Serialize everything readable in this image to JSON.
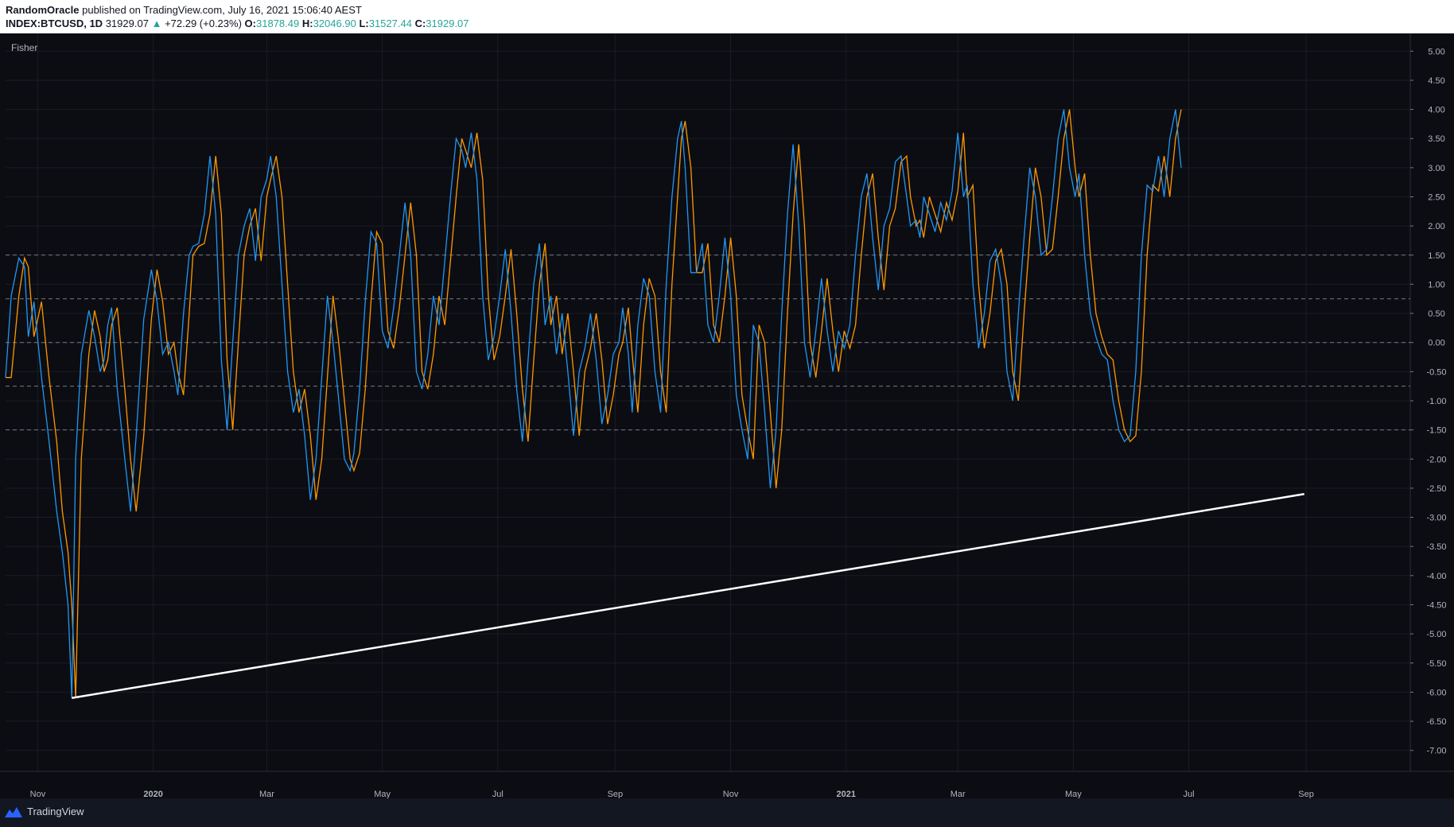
{
  "header": {
    "author": "RandomOracle",
    "published": "published on TradingView.com, July 16, 2021 15:06:40 AEST",
    "symbol": "INDEX:BTCUSD, 1D",
    "last_price": "31929.07",
    "change": "+72.29 (+0.23%)",
    "open_label": "O:",
    "open": "31878.49",
    "high_label": "H:",
    "high": "32046.90",
    "low_label": "L:",
    "low": "31527.44",
    "close_label": "C:",
    "close": "31929.07"
  },
  "indicator_label": "Fisher",
  "footer": {
    "brand": "TradingView",
    "logo_icon": "tradingview-logo-icon"
  },
  "colors": {
    "background": "#0c0d12",
    "fisher": "#2196f3",
    "trigger": "#ff9800",
    "trendline": "#ffffff",
    "levels": "#787b86",
    "axis_text": "#b2b5be",
    "up": "#26a69a"
  },
  "chart_data": {
    "type": "line",
    "title": "",
    "indicator": "Fisher",
    "x_axis": {
      "type": "date",
      "start": "2019-10-15",
      "end": "2021-10-26",
      "ticks": [
        {
          "date": "2019-11-01",
          "label": "Nov",
          "bold": false
        },
        {
          "date": "2020-01-01",
          "label": "2020",
          "bold": true
        },
        {
          "date": "2020-03-01",
          "label": "Mar",
          "bold": false
        },
        {
          "date": "2020-05-01",
          "label": "May",
          "bold": false
        },
        {
          "date": "2020-07-01",
          "label": "Jul",
          "bold": false
        },
        {
          "date": "2020-09-01",
          "label": "Sep",
          "bold": false
        },
        {
          "date": "2020-11-01",
          "label": "Nov",
          "bold": false
        },
        {
          "date": "2021-01-01",
          "label": "2021",
          "bold": true
        },
        {
          "date": "2021-03-01",
          "label": "Mar",
          "bold": false
        },
        {
          "date": "2021-05-01",
          "label": "May",
          "bold": false
        },
        {
          "date": "2021-07-01",
          "label": "Jul",
          "bold": false
        },
        {
          "date": "2021-09-01",
          "label": "Sep",
          "bold": false
        }
      ]
    },
    "y_axis": {
      "range": [
        -7.25,
        5.25
      ],
      "ticks": [
        "5.00",
        "4.50",
        "4.00",
        "3.50",
        "3.00",
        "2.50",
        "2.00",
        "1.50",
        "1.00",
        "0.50",
        "0.00",
        "-0.50",
        "-1.00",
        "-1.50",
        "-2.00",
        "-2.50",
        "-3.00",
        "-3.50",
        "-4.00",
        "-4.50",
        "-5.00",
        "-5.50",
        "-6.00",
        "-6.50",
        "-7.00"
      ]
    },
    "levels": [
      1.5,
      0.75,
      0,
      -0.75,
      -1.5
    ],
    "grid": true,
    "legend": "none",
    "series": [
      {
        "points": [
          [
            "2019-10-15",
            -0.6
          ],
          [
            "2019-10-18",
            0.8
          ],
          [
            "2019-10-22",
            1.45
          ],
          [
            "2019-10-25",
            1.3
          ],
          [
            "2019-10-27",
            0.1
          ],
          [
            "2019-10-30",
            0.7
          ],
          [
            "2019-11-03",
            -0.6
          ],
          [
            "2019-11-07",
            -1.7
          ],
          [
            "2019-11-11",
            -2.9
          ],
          [
            "2019-11-14",
            -3.6
          ],
          [
            "2019-11-17",
            -4.5
          ],
          [
            "2019-11-19",
            -6.1
          ],
          [
            "2019-11-21",
            -2.0
          ],
          [
            "2019-11-24",
            -0.2
          ],
          [
            "2019-11-28",
            0.55
          ],
          [
            "2019-12-01",
            0.1
          ],
          [
            "2019-12-04",
            -0.5
          ],
          [
            "2019-12-06",
            -0.3
          ],
          [
            "2019-12-08",
            0.3
          ],
          [
            "2019-12-10",
            0.6
          ],
          [
            "2019-12-13",
            -0.8
          ],
          [
            "2019-12-17",
            -2.0
          ],
          [
            "2019-12-20",
            -2.9
          ],
          [
            "2019-12-23",
            -1.6
          ],
          [
            "2019-12-27",
            0.4
          ],
          [
            "2019-12-31",
            1.25
          ],
          [
            "2020-01-03",
            0.7
          ],
          [
            "2020-01-06",
            -0.2
          ],
          [
            "2020-01-09",
            0.0
          ],
          [
            "2020-01-12",
            -0.5
          ],
          [
            "2020-01-14",
            -0.9
          ],
          [
            "2020-01-17",
            0.5
          ],
          [
            "2020-01-20",
            1.5
          ],
          [
            "2020-01-22",
            1.65
          ],
          [
            "2020-01-25",
            1.7
          ],
          [
            "2020-01-28",
            2.2
          ],
          [
            "2020-01-31",
            3.2
          ],
          [
            "2020-02-03",
            2.2
          ],
          [
            "2020-02-06",
            -0.3
          ],
          [
            "2020-02-09",
            -1.5
          ],
          [
            "2020-02-12",
            0.0
          ],
          [
            "2020-02-15",
            1.5
          ],
          [
            "2020-02-18",
            2.0
          ],
          [
            "2020-02-21",
            2.3
          ],
          [
            "2020-02-24",
            1.4
          ],
          [
            "2020-02-27",
            2.5
          ],
          [
            "2020-03-01",
            2.8
          ],
          [
            "2020-03-03",
            3.2
          ],
          [
            "2020-03-06",
            2.5
          ],
          [
            "2020-03-09",
            1.0
          ],
          [
            "2020-03-12",
            -0.5
          ],
          [
            "2020-03-15",
            -1.2
          ],
          [
            "2020-03-18",
            -0.8
          ],
          [
            "2020-03-21",
            -1.6
          ],
          [
            "2020-03-24",
            -2.7
          ],
          [
            "2020-03-27",
            -2.0
          ],
          [
            "2020-03-30",
            -0.6
          ],
          [
            "2020-04-02",
            0.8
          ],
          [
            "2020-04-05",
            0.0
          ],
          [
            "2020-04-08",
            -1.0
          ],
          [
            "2020-04-11",
            -2.0
          ],
          [
            "2020-04-14",
            -2.2
          ],
          [
            "2020-04-16",
            -1.9
          ],
          [
            "2020-04-19",
            -0.8
          ],
          [
            "2020-04-22",
            0.7
          ],
          [
            "2020-04-25",
            1.9
          ],
          [
            "2020-04-28",
            1.7
          ],
          [
            "2020-05-01",
            0.2
          ],
          [
            "2020-05-04",
            -0.1
          ],
          [
            "2020-05-07",
            0.6
          ],
          [
            "2020-05-10",
            1.5
          ],
          [
            "2020-05-13",
            2.4
          ],
          [
            "2020-05-16",
            1.5
          ],
          [
            "2020-05-19",
            -0.5
          ],
          [
            "2020-05-22",
            -0.8
          ],
          [
            "2020-05-25",
            -0.2
          ],
          [
            "2020-05-28",
            0.8
          ],
          [
            "2020-05-31",
            0.3
          ],
          [
            "2020-06-03",
            1.4
          ],
          [
            "2020-06-06",
            2.5
          ],
          [
            "2020-06-09",
            3.5
          ],
          [
            "2020-06-12",
            3.3
          ],
          [
            "2020-06-14",
            3.0
          ],
          [
            "2020-06-17",
            3.6
          ],
          [
            "2020-06-20",
            2.8
          ],
          [
            "2020-06-23",
            0.8
          ],
          [
            "2020-06-26",
            -0.3
          ],
          [
            "2020-06-29",
            0.1
          ],
          [
            "2020-07-02",
            0.8
          ],
          [
            "2020-07-05",
            1.6
          ],
          [
            "2020-07-08",
            0.5
          ],
          [
            "2020-07-11",
            -0.8
          ],
          [
            "2020-07-14",
            -1.7
          ],
          [
            "2020-07-17",
            -0.3
          ],
          [
            "2020-07-20",
            1.0
          ],
          [
            "2020-07-23",
            1.7
          ],
          [
            "2020-07-26",
            0.3
          ],
          [
            "2020-07-29",
            0.8
          ],
          [
            "2020-08-01",
            -0.2
          ],
          [
            "2020-08-04",
            0.5
          ],
          [
            "2020-08-07",
            -0.5
          ],
          [
            "2020-08-10",
            -1.6
          ],
          [
            "2020-08-13",
            -0.5
          ],
          [
            "2020-08-16",
            -0.1
          ],
          [
            "2020-08-19",
            0.5
          ],
          [
            "2020-08-22",
            -0.3
          ],
          [
            "2020-08-25",
            -1.4
          ],
          [
            "2020-08-28",
            -0.9
          ],
          [
            "2020-08-31",
            -0.2
          ],
          [
            "2020-09-03",
            0.0
          ],
          [
            "2020-09-05",
            0.6
          ],
          [
            "2020-09-08",
            -0.2
          ],
          [
            "2020-09-10",
            -1.2
          ],
          [
            "2020-09-13",
            0.3
          ],
          [
            "2020-09-16",
            1.1
          ],
          [
            "2020-09-19",
            0.8
          ],
          [
            "2020-09-22",
            -0.5
          ],
          [
            "2020-09-25",
            -1.2
          ],
          [
            "2020-09-28",
            1.0
          ],
          [
            "2020-10-01",
            2.5
          ],
          [
            "2020-10-04",
            3.5
          ],
          [
            "2020-10-06",
            3.8
          ],
          [
            "2020-10-08",
            3.0
          ],
          [
            "2020-10-11",
            1.2
          ],
          [
            "2020-10-14",
            1.2
          ],
          [
            "2020-10-17",
            1.7
          ],
          [
            "2020-10-20",
            0.3
          ],
          [
            "2020-10-23",
            0.0
          ],
          [
            "2020-10-26",
            0.8
          ],
          [
            "2020-10-29",
            1.8
          ],
          [
            "2020-11-01",
            0.8
          ],
          [
            "2020-11-04",
            -0.9
          ],
          [
            "2020-11-07",
            -1.5
          ],
          [
            "2020-11-10",
            -2.0
          ],
          [
            "2020-11-13",
            0.3
          ],
          [
            "2020-11-16",
            0.0
          ],
          [
            "2020-11-19",
            -1.2
          ],
          [
            "2020-11-22",
            -2.5
          ],
          [
            "2020-11-25",
            -1.5
          ],
          [
            "2020-11-28",
            0.5
          ],
          [
            "2020-12-01",
            2.2
          ],
          [
            "2020-12-04",
            3.4
          ],
          [
            "2020-12-07",
            2.0
          ],
          [
            "2020-12-10",
            0.0
          ],
          [
            "2020-12-13",
            -0.6
          ],
          [
            "2020-12-16",
            0.2
          ],
          [
            "2020-12-19",
            1.1
          ],
          [
            "2020-12-22",
            0.2
          ],
          [
            "2020-12-25",
            -0.5
          ],
          [
            "2020-12-28",
            0.2
          ],
          [
            "2020-12-31",
            -0.1
          ],
          [
            "2021-01-03",
            0.3
          ],
          [
            "2021-01-06",
            1.5
          ],
          [
            "2021-01-09",
            2.5
          ],
          [
            "2021-01-12",
            2.9
          ],
          [
            "2021-01-15",
            1.8
          ],
          [
            "2021-01-18",
            0.9
          ],
          [
            "2021-01-21",
            2.0
          ],
          [
            "2021-01-24",
            2.3
          ],
          [
            "2021-01-27",
            3.1
          ],
          [
            "2021-01-30",
            3.2
          ],
          [
            "2021-02-02",
            2.5
          ],
          [
            "2021-02-04",
            2.0
          ],
          [
            "2021-02-07",
            2.1
          ],
          [
            "2021-02-09",
            1.8
          ],
          [
            "2021-02-11",
            2.5
          ],
          [
            "2021-02-14",
            2.2
          ],
          [
            "2021-02-17",
            1.9
          ],
          [
            "2021-02-20",
            2.4
          ],
          [
            "2021-02-23",
            2.1
          ],
          [
            "2021-02-26",
            2.6
          ],
          [
            "2021-03-01",
            3.6
          ],
          [
            "2021-03-04",
            2.5
          ],
          [
            "2021-03-06",
            2.7
          ],
          [
            "2021-03-09",
            1.0
          ],
          [
            "2021-03-12",
            -0.1
          ],
          [
            "2021-03-15",
            0.5
          ],
          [
            "2021-03-18",
            1.4
          ],
          [
            "2021-03-21",
            1.6
          ],
          [
            "2021-03-24",
            1.0
          ],
          [
            "2021-03-27",
            -0.5
          ],
          [
            "2021-03-30",
            -1.0
          ],
          [
            "2021-04-02",
            0.5
          ],
          [
            "2021-04-05",
            1.8
          ],
          [
            "2021-04-08",
            3.0
          ],
          [
            "2021-04-11",
            2.5
          ],
          [
            "2021-04-14",
            1.5
          ],
          [
            "2021-04-17",
            1.6
          ],
          [
            "2021-04-20",
            2.5
          ],
          [
            "2021-04-23",
            3.5
          ],
          [
            "2021-04-26",
            4.0
          ],
          [
            "2021-04-29",
            3.0
          ],
          [
            "2021-05-02",
            2.5
          ],
          [
            "2021-05-04",
            2.9
          ],
          [
            "2021-05-07",
            1.5
          ],
          [
            "2021-05-10",
            0.5
          ],
          [
            "2021-05-13",
            0.1
          ],
          [
            "2021-05-16",
            -0.2
          ],
          [
            "2021-05-19",
            -0.3
          ],
          [
            "2021-05-22",
            -1.0
          ],
          [
            "2021-05-25",
            -1.5
          ],
          [
            "2021-05-28",
            -1.7
          ],
          [
            "2021-05-31",
            -1.6
          ],
          [
            "2021-06-03",
            -0.5
          ],
          [
            "2021-06-06",
            1.5
          ],
          [
            "2021-06-09",
            2.7
          ],
          [
            "2021-06-12",
            2.6
          ],
          [
            "2021-06-15",
            3.2
          ],
          [
            "2021-06-18",
            2.5
          ],
          [
            "2021-06-21",
            3.5
          ],
          [
            "2021-06-24",
            4.0
          ],
          [
            "2021-06-27",
            3.0
          ]
        ]
      },
      {
        "name": "",
        "points": []
      }
    ],
    "trendline": {
      "from": [
        "2019-11-19",
        -6.1
      ],
      "to": [
        "2021-08-31",
        -2.6
      ]
    }
  }
}
